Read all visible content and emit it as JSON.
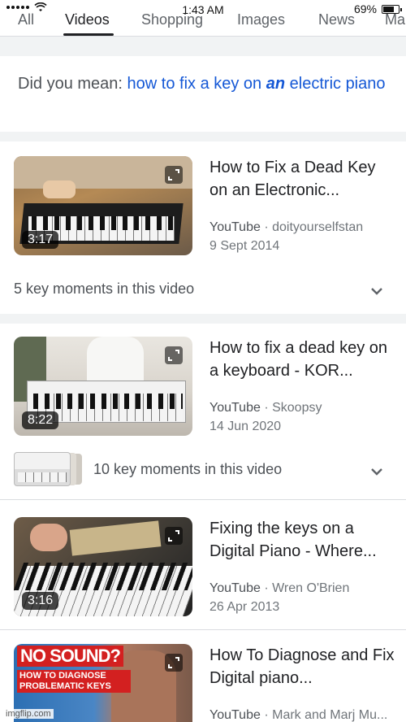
{
  "status_bar": {
    "time": "1:43 AM",
    "battery": "69%"
  },
  "tabs": [
    {
      "label": "All"
    },
    {
      "label": "Videos",
      "active": true
    },
    {
      "label": "Shopping"
    },
    {
      "label": "Images"
    },
    {
      "label": "News"
    },
    {
      "label": "Ma"
    }
  ],
  "did_you_mean": {
    "prefix": "Did you mean:",
    "suggestion_before": "how to fix a key on",
    "suggestion_emphasis": "an",
    "suggestion_after": "electric piano"
  },
  "videos": [
    {
      "title": "How to Fix a Dead Key on an Electronic...",
      "source": "YouTube",
      "channel": "doityourselfstan",
      "date": "9 Sept 2014",
      "duration": "3:17",
      "moments": "5 key moments in this video"
    },
    {
      "title": "How to fix a dead key on a keyboard - KOR...",
      "source": "YouTube",
      "channel": "Skoopsy",
      "date": "14 Jun 2020",
      "duration": "8:22",
      "moments": "10 key moments in this video"
    },
    {
      "title": "Fixing the keys on a Digital Piano - Where...",
      "source": "YouTube",
      "channel": "Wren O'Brien",
      "date": "26 Apr 2013",
      "duration": "3:16"
    },
    {
      "title": "How To Diagnose and Fix Digital piano...",
      "source": "YouTube",
      "channel": "Mark and Marj Mu...",
      "thumb_text_1": "NO SOUND?",
      "thumb_text_2": "HOW TO DIAGNOSE PROBLEMATIC KEYS"
    }
  ],
  "separator": "·",
  "watermark": "imgflip.com",
  "colors": {
    "link": "#1558d6",
    "band": "#f1f3f4"
  }
}
